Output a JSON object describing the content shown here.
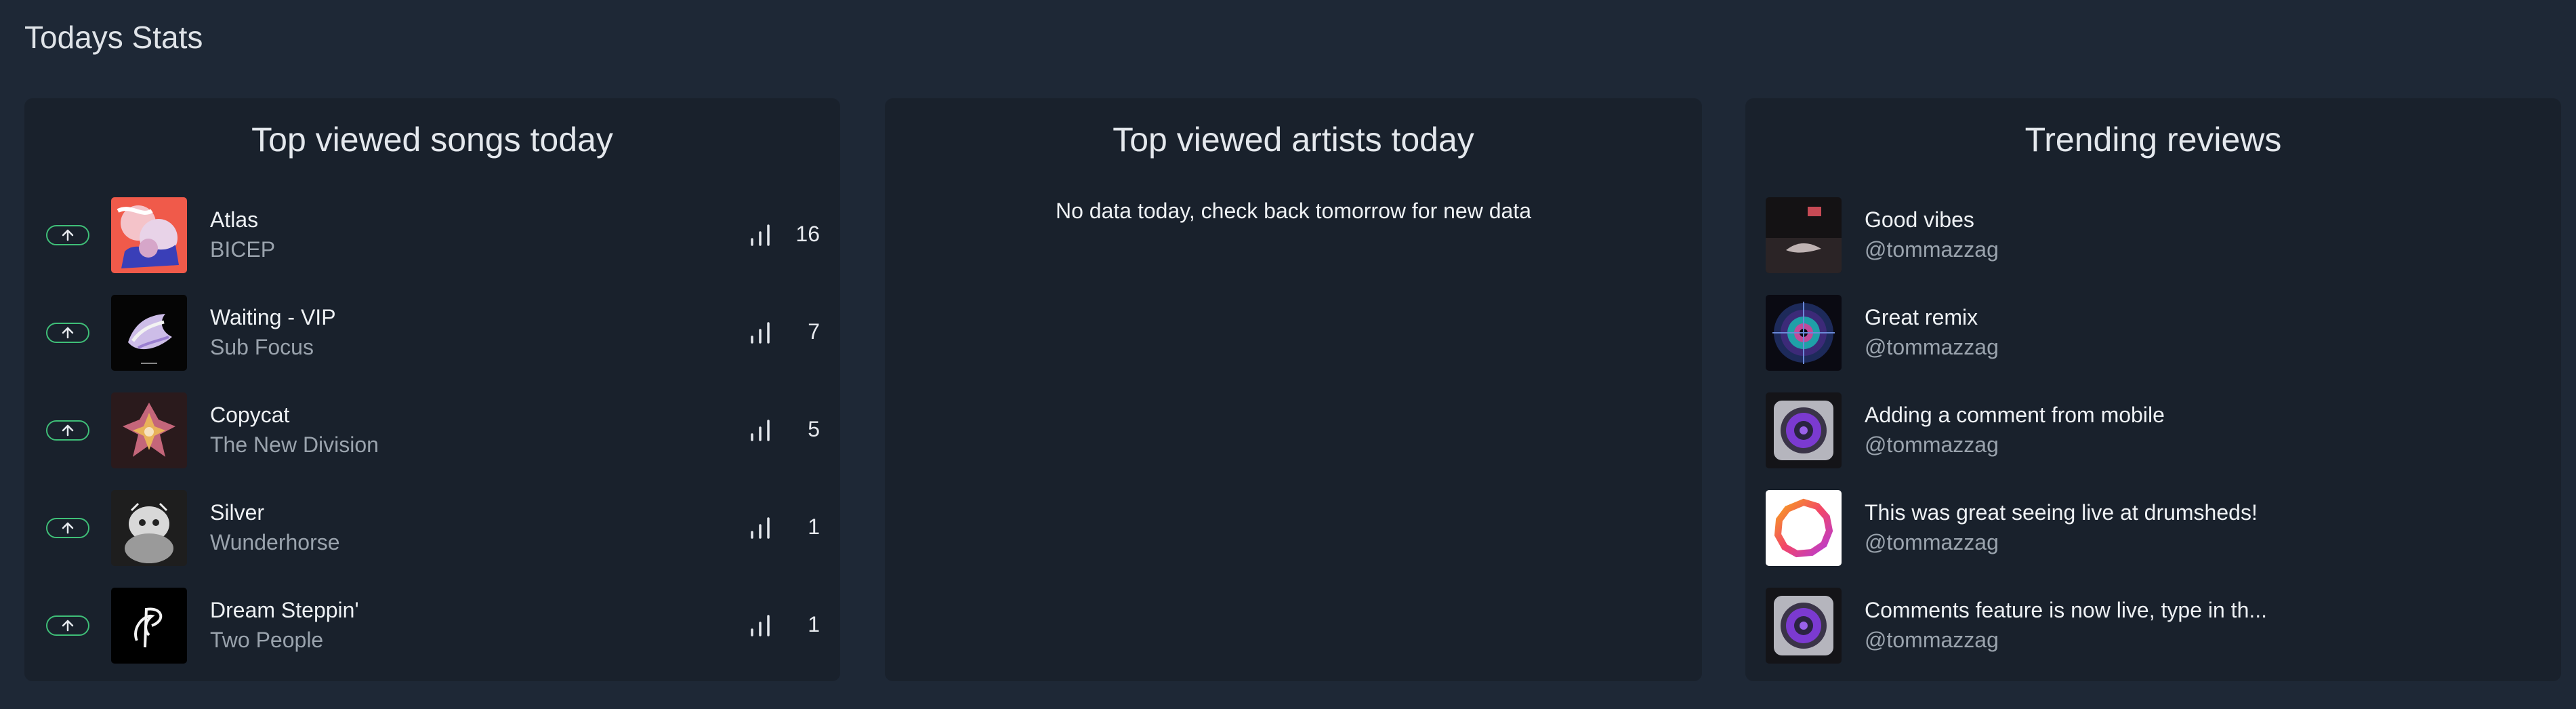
{
  "page_title": "Todays Stats",
  "songs_panel": {
    "title": "Top viewed songs today",
    "items": [
      {
        "title": "Atlas",
        "artist": "BICEP",
        "views": "16"
      },
      {
        "title": "Waiting - VIP",
        "artist": "Sub Focus",
        "views": "7"
      },
      {
        "title": "Copycat",
        "artist": "The New Division",
        "views": "5"
      },
      {
        "title": "Silver",
        "artist": "Wunderhorse",
        "views": "1"
      },
      {
        "title": "Dream Steppin'",
        "artist": "Two People",
        "views": "1"
      }
    ]
  },
  "artists_panel": {
    "title": "Top viewed artists today",
    "empty_message": "No data today, check back tomorrow for new data"
  },
  "reviews_panel": {
    "title": "Trending reviews",
    "items": [
      {
        "title": "Good vibes",
        "user": "@tommazzag"
      },
      {
        "title": "Great remix",
        "user": "@tommazzag"
      },
      {
        "title": "Adding a comment from mobile",
        "user": "@tommazzag"
      },
      {
        "title": "This was great seeing live at drumsheds!",
        "user": "@tommazzag"
      },
      {
        "title": "Comments feature is now live, type in th...",
        "user": "@tommazzag"
      }
    ]
  },
  "colors": {
    "background": "#1e2836",
    "panel": "#19212c",
    "trend_up": "#3fbf78",
    "muted_text": "#9aa3ad"
  },
  "icons": {
    "trend": "arrow-up-icon",
    "views": "bar-chart-icon"
  }
}
